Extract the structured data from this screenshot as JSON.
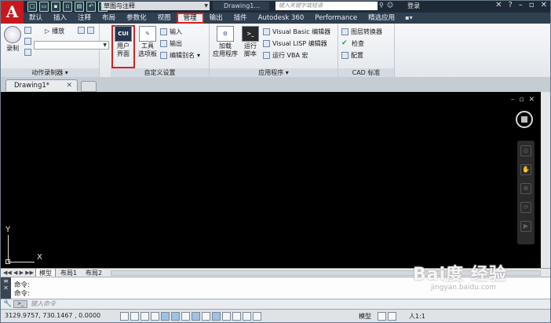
{
  "qat": {
    "workspace": "草图与注释",
    "document": "Drawing1...",
    "search_placeholder": "键入关键字或短语",
    "login": "登录"
  },
  "tabs": [
    {
      "label": "默认"
    },
    {
      "label": "插入"
    },
    {
      "label": "注释"
    },
    {
      "label": "布局"
    },
    {
      "label": "参数化"
    },
    {
      "label": "视图"
    },
    {
      "label": "管理"
    },
    {
      "label": "输出"
    },
    {
      "label": "插件"
    },
    {
      "label": "Autodesk 360"
    },
    {
      "label": "Performance"
    },
    {
      "label": "精选应用"
    }
  ],
  "ribbon": {
    "action_recorder": {
      "title": "动作录制器",
      "record": "录制",
      "play": "播放"
    },
    "customization": {
      "title": "自定义设置",
      "user_interface": "用户\n界面",
      "cui_label": "CUI",
      "tool_palettes": "工具\n选项板",
      "import": "输入",
      "export": "输出",
      "edit_aliases": "编辑别名"
    },
    "applications": {
      "title": "应用程序",
      "load_app": "加载\n应用程序",
      "run_script": "运行\n脚本",
      "vb_editor": "Visual Basic 编辑器",
      "lisp_editor": "Visual LISP 编辑器",
      "run_vba": "运行 VBA 宏"
    },
    "cad_standards": {
      "title": "CAD 标准",
      "layer_translator": "图层转换器",
      "check": "检查",
      "configure": "配置"
    }
  },
  "doc_tabs": [
    {
      "label": "Drawing1*"
    }
  ],
  "layout_tabs": [
    {
      "label": "模型"
    },
    {
      "label": "布局1"
    },
    {
      "label": "布局2"
    }
  ],
  "ucs": {
    "x": "X",
    "y": "Y"
  },
  "command": {
    "lines": [
      "命令:",
      "命令:"
    ],
    "placeholder": "键入命令"
  },
  "status": {
    "coords": "3129.9757, 730.1467 , 0.0000",
    "model": "模型",
    "scale": "人1:1"
  },
  "watermark": {
    "logo": "Bai度 经验",
    "url": "jingyan.baidu.com"
  }
}
